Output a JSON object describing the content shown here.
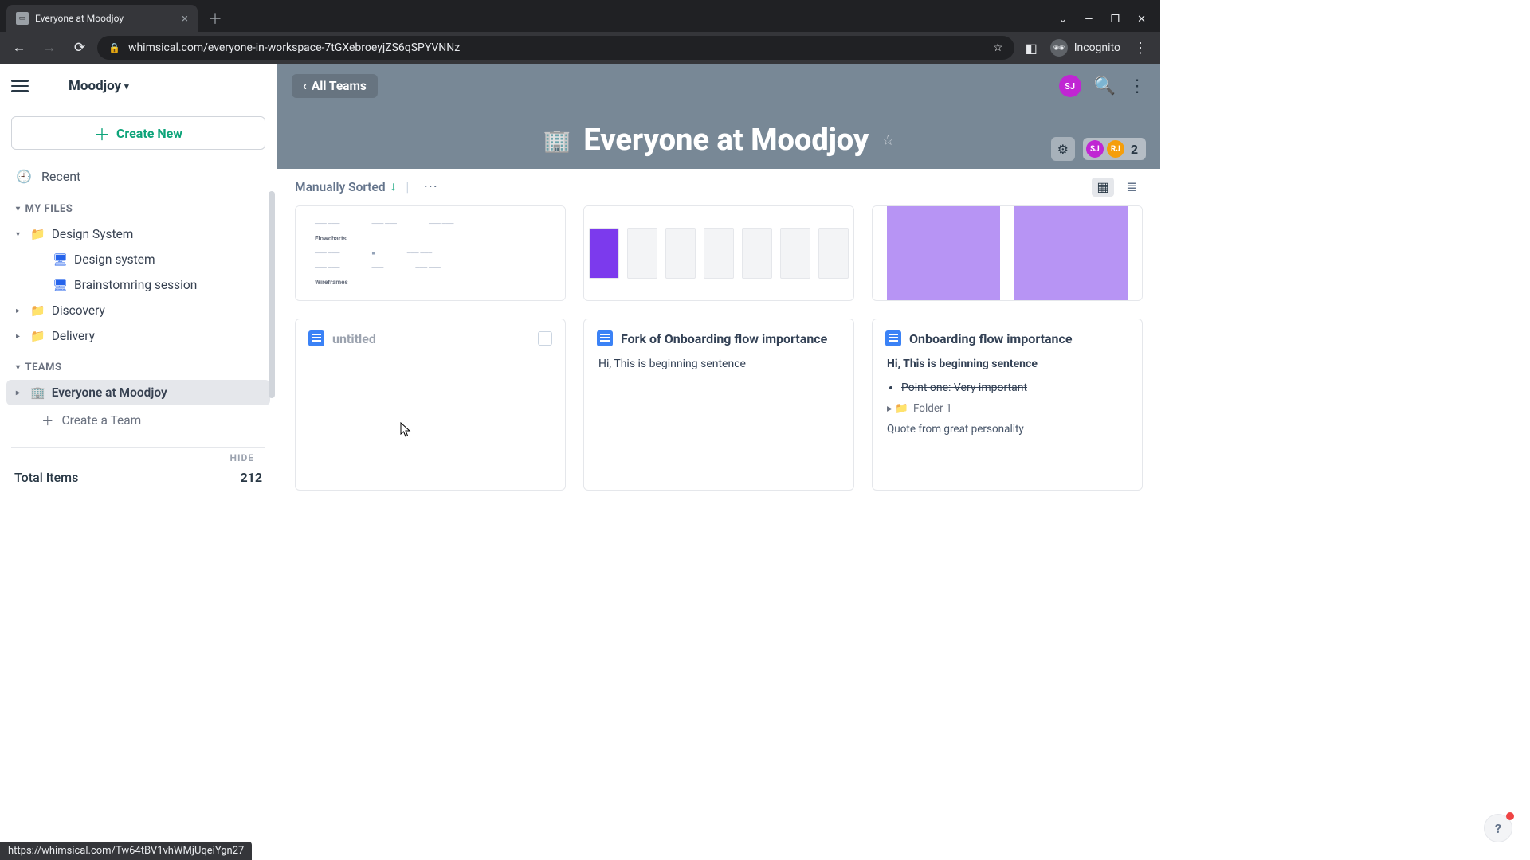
{
  "browser": {
    "tab_title": "Everyone at Moodjoy",
    "url": "whimsical.com/everyone-in-workspace-7tGXebroeyjZS6qSPYVNNz",
    "incognito_label": "Incognito"
  },
  "sidebar": {
    "workspace_name": "Moodjoy",
    "create_label": "Create New",
    "recent_label": "Recent",
    "sections": {
      "my_files": "MY FILES",
      "teams": "TEAMS"
    },
    "folders": {
      "design_system": "Design System",
      "design_system_sub": "Design system",
      "brainstorming": "Brainstomring session",
      "discovery": "Discovery",
      "delivery": "Delivery"
    },
    "team_item": "Everyone at Moodjoy",
    "create_team": "Create a Team",
    "hide_label": "HIDE",
    "total_label": "Total Items",
    "total_count": "212"
  },
  "topbar": {
    "back_label": "All Teams",
    "avatar_initials": "SJ"
  },
  "hero": {
    "title": "Everyone at Moodjoy",
    "member_count": "2",
    "mini1": "SJ",
    "mini2": "RJ"
  },
  "content": {
    "sort_label": "Manually Sorted",
    "flow_labels": {
      "flowcharts": "Flowcharts",
      "wireframes": "Wireframes"
    },
    "cards": {
      "untitled": "untitled",
      "fork_title": "Fork of Onboarding flow importance",
      "fork_body": "Hi, This is beginning sentence",
      "onboard_title": "Onboarding flow importance",
      "onboard_b1": "Hi, This is beginning sentence",
      "onboard_li": "Point one: Very important",
      "onboard_folder": "Folder 1",
      "onboard_quote": "Quote from great personality"
    }
  },
  "status_url": "https://whimsical.com/Tw64tBV1vhWMjUqeiYgn27",
  "help": "?"
}
